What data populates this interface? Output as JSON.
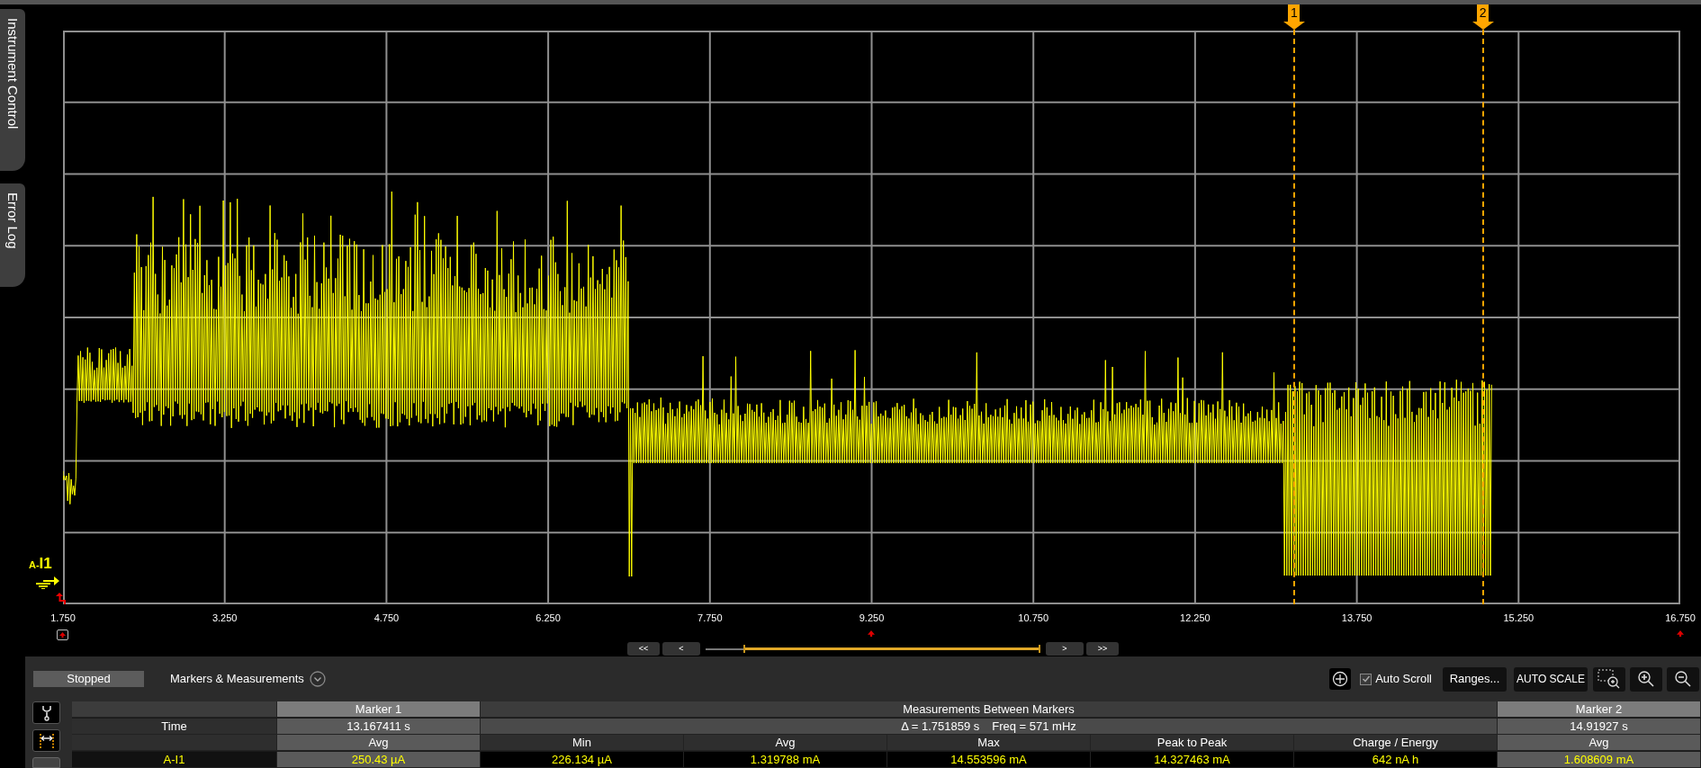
{
  "side_tabs": [
    {
      "label": "Instrument Control"
    },
    {
      "label": "Error Log"
    }
  ],
  "plot": {
    "channel_prefix": "A-",
    "channel": "I1",
    "markers": [
      {
        "label": "1"
      },
      {
        "label": "2"
      }
    ],
    "x_axis_labels": [
      "1.750",
      "3.250",
      "4.750",
      "6.250",
      "7.750",
      "9.250",
      "10.750",
      "12.250",
      "13.750",
      "15.250",
      "16.750"
    ]
  },
  "scroller": {
    "buttons": [
      "<<",
      "<",
      ">",
      ">>"
    ]
  },
  "panel": {
    "status": "Stopped",
    "section_title": "Markers & Measurements",
    "auto_scroll": {
      "label": "Auto Scroll",
      "checked": true
    },
    "buttons": [
      "Ranges...",
      "AUTO SCALE"
    ]
  },
  "table": {
    "marker1_title": "Marker 1",
    "between_title": "Measurements Between Markers",
    "marker2_title": "Marker 2",
    "time_label": "Time",
    "marker1_time": "13.167411 s",
    "delta": "Δ = 1.751859 s",
    "freq": "Freq = 571 mHz",
    "marker2_time": "14.91927 s",
    "columns": [
      "Avg",
      "Min",
      "Avg",
      "Max",
      "Peak to Peak",
      "Charge / Energy",
      "Avg"
    ],
    "rows": [
      {
        "channel": "A-I1",
        "values": [
          "250.43 µA",
          "226.134 µA",
          "1.319788 mA",
          "14.553596 mA",
          "14.327463 mA",
          "642 nA h",
          "1.608609 mA"
        ]
      }
    ]
  }
}
